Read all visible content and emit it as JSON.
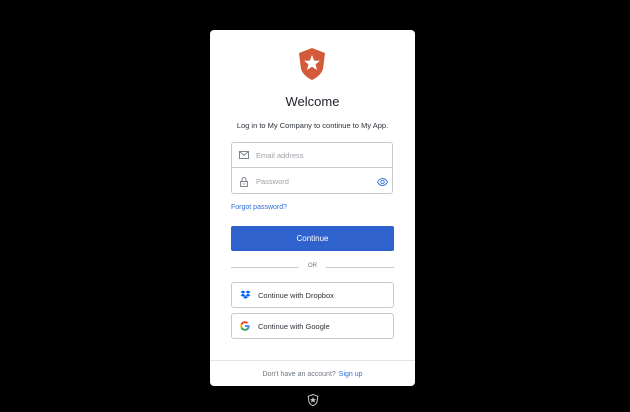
{
  "title": "Welcome",
  "subtitle": "Log in to My Company to continue to My App.",
  "email": {
    "value": "",
    "placeholder": "Email address",
    "icon": "mail-icon"
  },
  "password": {
    "value": "",
    "placeholder": "Password",
    "icon": "lock-icon",
    "toggle_icon": "eye-icon"
  },
  "forgot_label": "Forgot password?",
  "continue_label": "Continue",
  "divider_label": "OR",
  "social": [
    {
      "label": "Continue with Dropbox",
      "icon": "dropbox-icon"
    },
    {
      "label": "Continue with Google",
      "icon": "google-icon"
    }
  ],
  "footer": {
    "prompt": "Don't have an account?",
    "signup_label": "Sign up"
  },
  "colors": {
    "accent": "#2f62cc",
    "link": "#2f6fd6",
    "brand": "#d35a3a"
  }
}
